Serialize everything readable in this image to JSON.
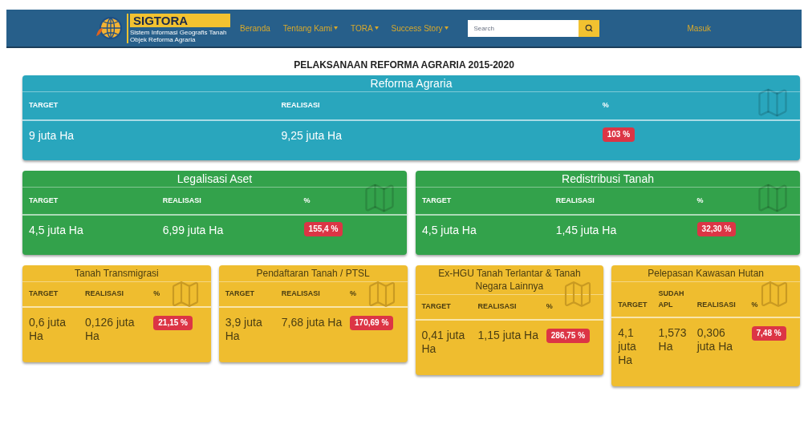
{
  "navbar": {
    "logo": {
      "name": "SIGTORA",
      "subtitle": "Sistem Informasi Geografis Tanah Objek Reforma Agraria"
    },
    "menu": [
      {
        "label": "Beranda",
        "dropdown": false
      },
      {
        "label": "Tentang Kami",
        "dropdown": true
      },
      {
        "label": "TORA",
        "dropdown": true
      },
      {
        "label": "Success Story",
        "dropdown": true
      }
    ],
    "search": {
      "placeholder": "Search"
    },
    "login": "Masuk"
  },
  "page_title": "PELAKSANAAN REFORMA AGRARIA 2015-2020",
  "rows": [
    [
      {
        "title": "Reforma Agraria",
        "color": "#29a6bd",
        "columns": [
          "TARGET",
          "REALISASI",
          "%"
        ],
        "values": [
          "9 juta Ha",
          "9,25 juta Ha"
        ],
        "badge": "103 %"
      }
    ],
    [
      {
        "title": "Legalisasi Aset",
        "color": "#33a24b",
        "columns": [
          "TARGET",
          "REALISASI",
          "%"
        ],
        "values": [
          "4,5 juta Ha",
          "6,99 juta Ha"
        ],
        "badge": "155,4 %"
      },
      {
        "title": "Redistribusi Tanah",
        "color": "#33a24b",
        "columns": [
          "TARGET",
          "REALISASI",
          "%"
        ],
        "values": [
          "4,5 juta Ha",
          "1,45 juta Ha"
        ],
        "badge": "32,30 %"
      }
    ],
    [
      {
        "title": "Tanah Transmigrasi",
        "color": "#efbd2f",
        "columns": [
          "TARGET",
          "REALISASI",
          "%"
        ],
        "values": [
          "0,6 juta Ha",
          "0,126 juta Ha"
        ],
        "badge": "21,15 %"
      },
      {
        "title": "Pendaftaran Tanah / PTSL",
        "color": "#efbd2f",
        "columns": [
          "TARGET",
          "REALISASI",
          "%"
        ],
        "values": [
          "3,9 juta Ha",
          "7,68 juta Ha"
        ],
        "badge": "170,69 %"
      },
      {
        "title": "Ex-HGU Tanah Terlantar & Tanah Negara Lainnya",
        "color": "#efbd2f",
        "columns": [
          "TARGET",
          "REALISASI",
          "%"
        ],
        "values": [
          "0,41 juta Ha",
          "1,15 juta Ha"
        ],
        "badge": "286,75 %"
      },
      {
        "title": "Pelepasan Kawasan Hutan",
        "color": "#efbd2f",
        "columns": [
          "TARGET",
          "SUDAH APL",
          "REALISASI",
          "%"
        ],
        "values": [
          "4,1 juta Ha",
          "1,573 Ha",
          "0,306 juta Ha"
        ],
        "badge": "7,48 %"
      }
    ]
  ]
}
